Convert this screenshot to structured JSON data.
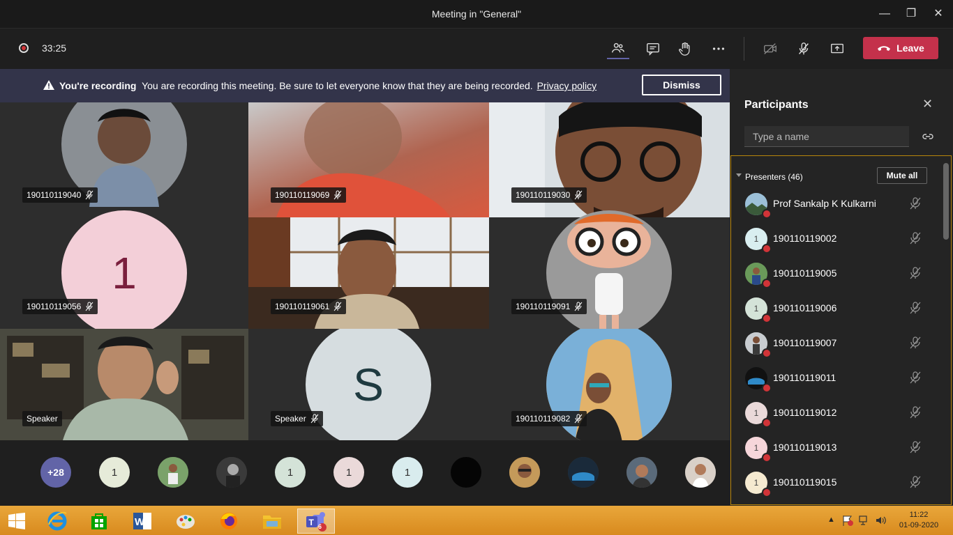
{
  "window": {
    "title": "Meeting in \"General\"",
    "minimize": "—",
    "maximize": "❐",
    "close": "✕"
  },
  "toolbar": {
    "timer": "33:25",
    "leave_label": "Leave"
  },
  "banner": {
    "title": "You're recording",
    "message": "You are recording this meeting. Be sure to let everyone know that they are being recorded.",
    "link": "Privacy policy",
    "dismiss": "Dismiss"
  },
  "tiles": [
    {
      "name": "190110119040",
      "kind": "photo",
      "bg": "#8a8f94"
    },
    {
      "name": "190110119069",
      "kind": "video",
      "bg": "#b56a52"
    },
    {
      "name": "190110119030",
      "kind": "video",
      "bg": "#cfd3d4"
    },
    {
      "name": "190110119056",
      "kind": "initial",
      "initial": "1",
      "bg": "#f3cfd8",
      "fg": "#7a1f3d"
    },
    {
      "name": "190110119061",
      "kind": "video",
      "bg": "#6a5a4a"
    },
    {
      "name": "190110119091",
      "kind": "photo",
      "bg": "#9a9a9a"
    },
    {
      "name": "Speaker",
      "kind": "video",
      "bg": "#6f6e5e"
    },
    {
      "name": "Speaker",
      "kind": "initial",
      "initial": "S",
      "bg": "#d6dde0",
      "fg": "#1f3a40"
    },
    {
      "name": "190110119082",
      "kind": "photo",
      "bg": "#c89a55"
    }
  ],
  "strip": {
    "overflow": "+28",
    "avatars": [
      {
        "text": "1",
        "bg": "#e6ebd9"
      },
      {
        "text": "",
        "bg": "#5b7a4a"
      },
      {
        "text": "",
        "bg": "#444444"
      },
      {
        "text": "1",
        "bg": "#d4e3d8"
      },
      {
        "text": "1",
        "bg": "#ead9d9"
      },
      {
        "text": "1",
        "bg": "#d9ecee"
      },
      {
        "text": "",
        "bg": "#050505"
      },
      {
        "text": "",
        "bg": "#b0894a"
      },
      {
        "text": "",
        "bg": "#3a4a5a"
      },
      {
        "text": "",
        "bg": "#6a5a4a"
      },
      {
        "text": "",
        "bg": "#c9c0b8"
      }
    ]
  },
  "participants": {
    "title": "Participants",
    "search_placeholder": "Type a name",
    "section": "Presenters (46)",
    "mute_all": "Mute all",
    "list": [
      {
        "name": "Prof Sankalp K Kulkarni",
        "initial": "",
        "bg": "#5b7f95"
      },
      {
        "name": "190110119002",
        "initial": "1",
        "bg": "#d9eef0"
      },
      {
        "name": "190110119005",
        "initial": "",
        "bg": "#4e7a4a"
      },
      {
        "name": "190110119006",
        "initial": "1",
        "bg": "#d4e3d8"
      },
      {
        "name": "190110119007",
        "initial": "",
        "bg": "#9fa6a0"
      },
      {
        "name": "190110119011",
        "initial": "",
        "bg": "#20303a"
      },
      {
        "name": "190110119012",
        "initial": "1",
        "bg": "#ead9d9"
      },
      {
        "name": "190110119013",
        "initial": "1",
        "bg": "#f6d6da"
      },
      {
        "name": "190110119015",
        "initial": "1",
        "bg": "#f5ead0"
      }
    ]
  },
  "taskbar": {
    "teams_badge": "6",
    "time": "11:22",
    "date": "01-09-2020"
  },
  "colors": {
    "leave": "#c4314b",
    "banner": "#33344a",
    "accent": "#6264a7"
  }
}
